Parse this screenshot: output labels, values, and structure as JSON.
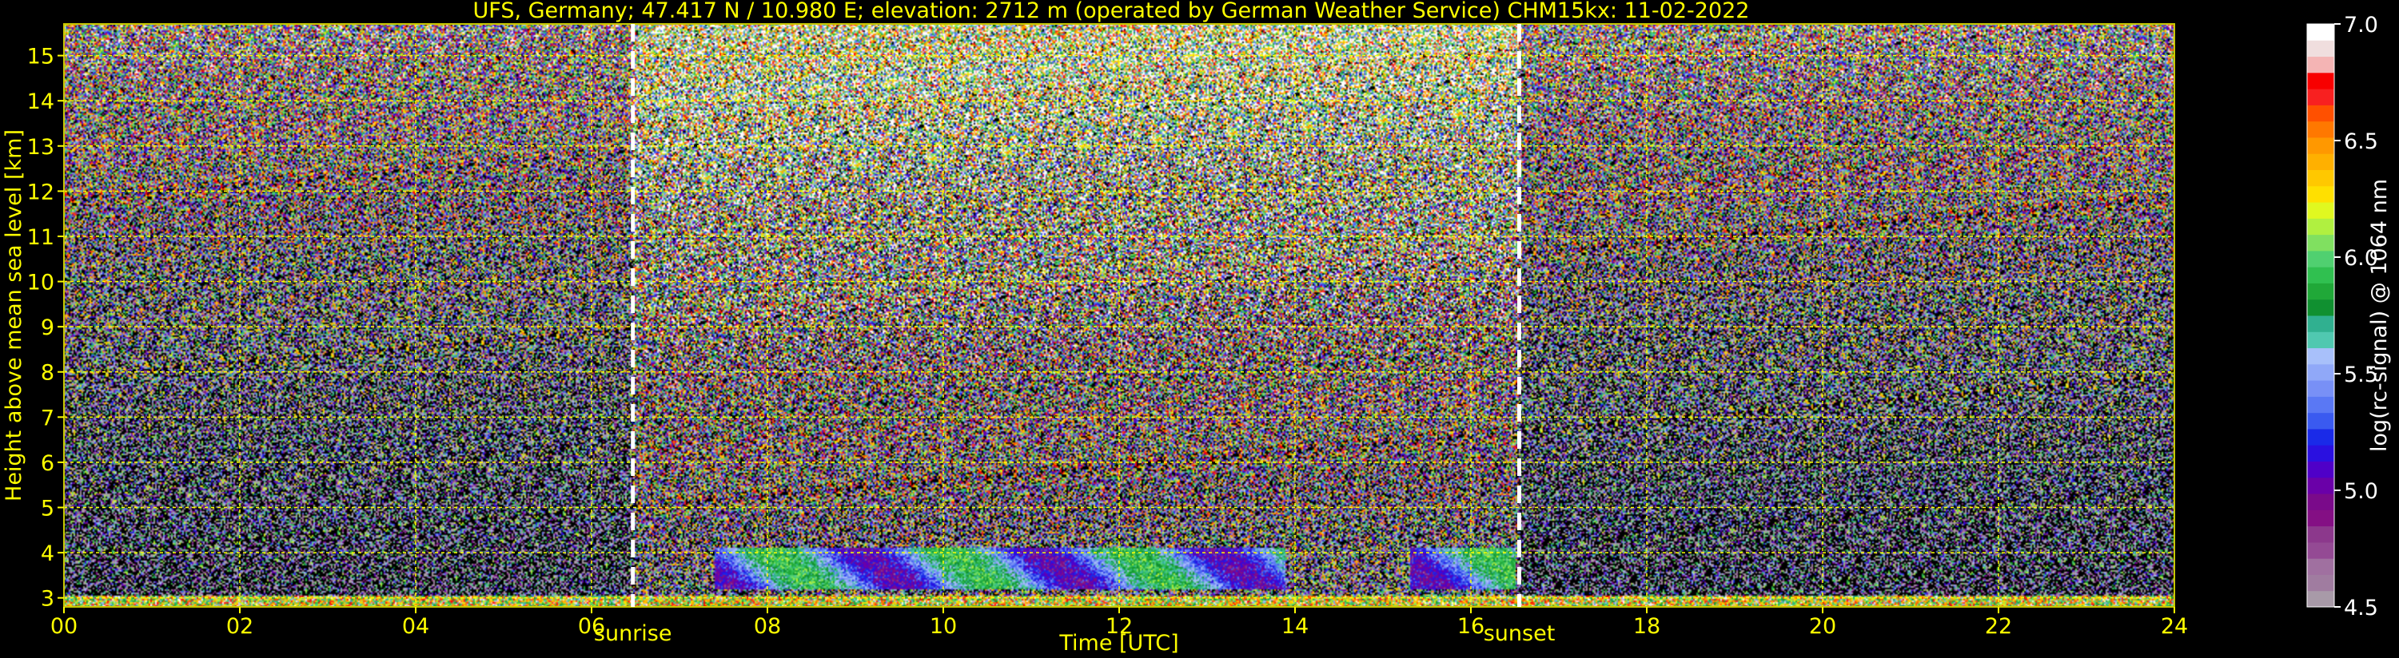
{
  "chart_data": {
    "type": "heatmap",
    "title": "UFS, Germany; 47.417 N / 10.980 E; elevation: 2712 m  (operated by German Weather Service)    CHM15kx: 11-02-2022",
    "xlabel": "Time [UTC]",
    "ylabel": "Height above mean sea level [km]",
    "xlim": [
      0,
      24
    ],
    "ylim": [
      2.8,
      15.7
    ],
    "x_ticks": [
      "00",
      "02",
      "04",
      "06",
      "08",
      "10",
      "12",
      "14",
      "16",
      "18",
      "20",
      "22",
      "24"
    ],
    "y_ticks": [
      "3",
      "4",
      "5",
      "6",
      "7",
      "8",
      "9",
      "10",
      "11",
      "12",
      "13",
      "14",
      "15"
    ],
    "grid": true,
    "annotations": [
      {
        "text": "sunrise",
        "x": 6.47
      },
      {
        "text": "sunset",
        "x": 16.55
      }
    ],
    "colorbar": {
      "label": "log(rc-signal) @ 1064 nm",
      "range": [
        4.5,
        7.0
      ],
      "ticks": [
        "7.0",
        "6.5",
        "6.0",
        "5.5",
        "5.0",
        "4.5"
      ],
      "colors": [
        "#a89aa8",
        "#a07ca0",
        "#a070a0",
        "#944a94",
        "#8c388c",
        "#840f84",
        "#7a0a8a",
        "#6a00a8",
        "#4f00c8",
        "#2a10e0",
        "#1a2ae8",
        "#3a5af0",
        "#5a78f4",
        "#7890f6",
        "#90a8f8",
        "#a8c0fa",
        "#50c8b0",
        "#30b090",
        "#109030",
        "#20a838",
        "#30c050",
        "#50d070",
        "#80e060",
        "#b0f040",
        "#e0f820",
        "#ffe000",
        "#ffc800",
        "#ffb000",
        "#ff9800",
        "#ff7800",
        "#ff5000",
        "#f82020",
        "#f80000",
        "#f4b4b4",
        "#f0dede",
        "#ffffff"
      ]
    },
    "signal_model": {
      "cloud_layer_km": [
        3.2,
        4.1
      ],
      "cloud_periods_utc": [
        [
          7.4,
          13.9
        ],
        [
          15.3,
          16.5
        ]
      ],
      "day_period_utc": [
        6.47,
        16.55
      ]
    }
  }
}
